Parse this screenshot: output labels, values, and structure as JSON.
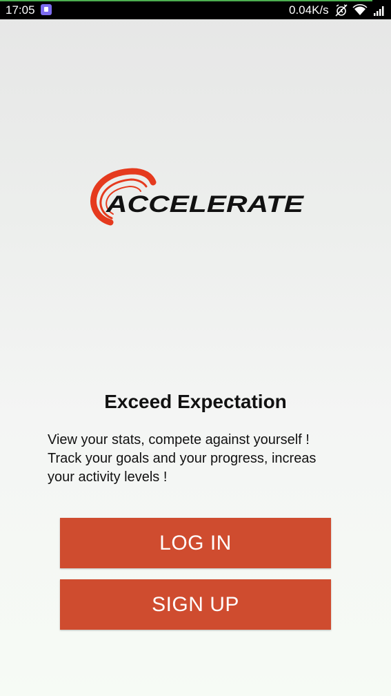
{
  "status_bar": {
    "time": "17:05",
    "network_speed": "0.04K/s",
    "icons": [
      "app-notification-icon",
      "alarm-off-icon",
      "wifi-icon",
      "signal-icon"
    ]
  },
  "logo": {
    "text": "ACCELERATE",
    "brand_red": "#e53a1e",
    "text_color": "#111111"
  },
  "headline": "Exceed Expectation",
  "description": "View your stats, compete against yourself !\nTrack your goals and your progress, increas\nyour activity levels !",
  "buttons": {
    "login_label": "LOG IN",
    "signup_label": "SIGN UP",
    "color": "#cf4c2f"
  }
}
